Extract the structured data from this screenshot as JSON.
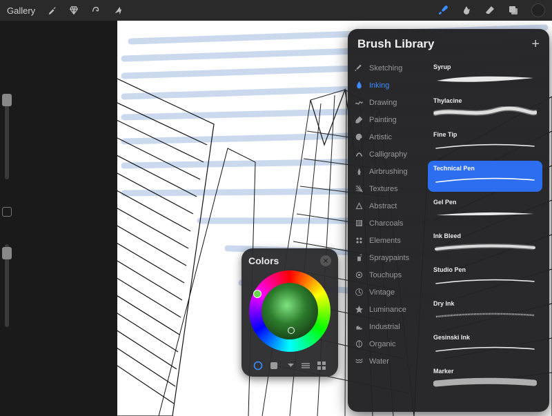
{
  "topbar": {
    "gallery_label": "Gallery"
  },
  "colors": {
    "title": "Colors"
  },
  "brush_library": {
    "title": "Brush Library",
    "categories": [
      {
        "icon": "pencil",
        "label": "Sketching"
      },
      {
        "icon": "ink",
        "label": "Inking"
      },
      {
        "icon": "squiggle",
        "label": "Drawing"
      },
      {
        "icon": "paintbrush",
        "label": "Painting"
      },
      {
        "icon": "palette",
        "label": "Artistic"
      },
      {
        "icon": "calligraphy",
        "label": "Calligraphy"
      },
      {
        "icon": "airbrush",
        "label": "Airbrushing"
      },
      {
        "icon": "texture",
        "label": "Textures"
      },
      {
        "icon": "abstract",
        "label": "Abstract"
      },
      {
        "icon": "charcoal",
        "label": "Charcoals"
      },
      {
        "icon": "elements",
        "label": "Elements"
      },
      {
        "icon": "spray",
        "label": "Spraypaints"
      },
      {
        "icon": "touchup",
        "label": "Touchups"
      },
      {
        "icon": "vintage",
        "label": "Vintage"
      },
      {
        "icon": "luminance",
        "label": "Luminance"
      },
      {
        "icon": "industrial",
        "label": "Industrial"
      },
      {
        "icon": "organic",
        "label": "Organic"
      },
      {
        "icon": "water",
        "label": "Water"
      }
    ],
    "active_category": "Inking",
    "brushes": [
      {
        "label": "Syrup",
        "stroke": "thick"
      },
      {
        "label": "Thylacine",
        "stroke": "rough"
      },
      {
        "label": "Fine Tip",
        "stroke": "thin"
      },
      {
        "label": "Technical Pen",
        "stroke": "thin"
      },
      {
        "label": "Gel Pen",
        "stroke": "taper"
      },
      {
        "label": "Ink Bleed",
        "stroke": "bleed"
      },
      {
        "label": "Studio Pen",
        "stroke": "thin"
      },
      {
        "label": "Dry Ink",
        "stroke": "dry"
      },
      {
        "label": "Gesinski Ink",
        "stroke": "thin"
      },
      {
        "label": "Marker",
        "stroke": "marker"
      }
    ],
    "selected_brush": "Technical Pen"
  }
}
